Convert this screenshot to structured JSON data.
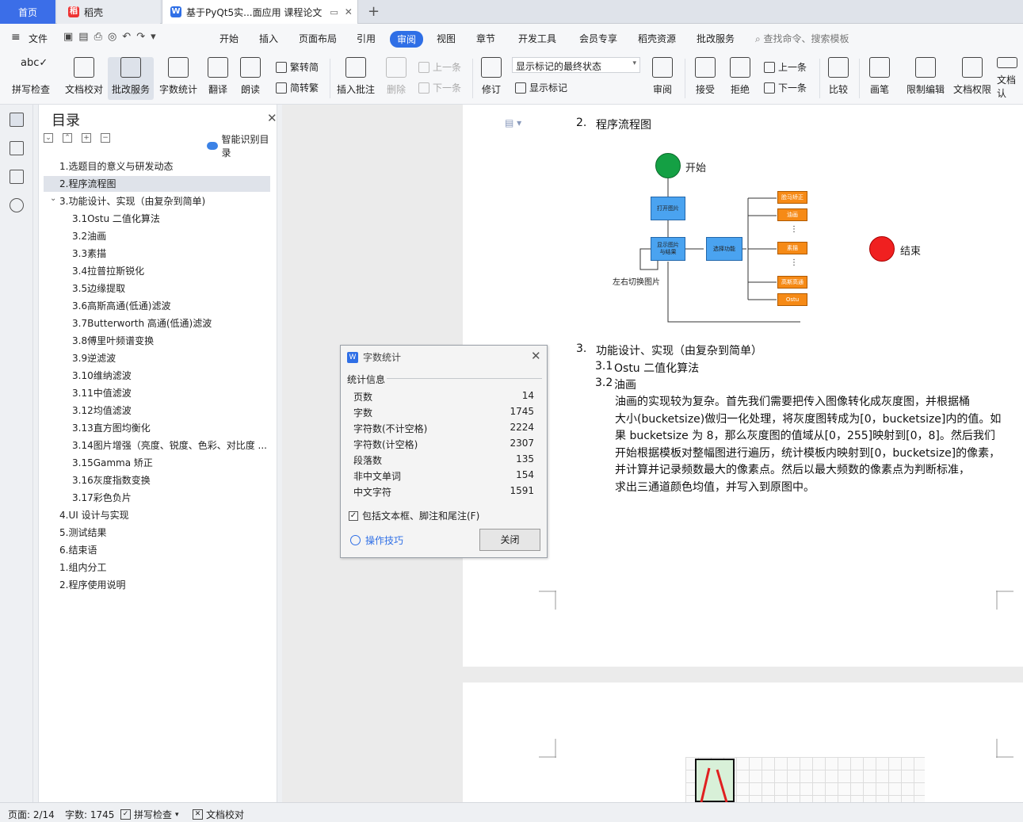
{
  "tabs": {
    "home": "首页",
    "daoke": "稻壳",
    "doc": "基于PyQt5实...面应用 课程论文"
  },
  "menubar": {
    "file": "文件",
    "items": [
      "开始",
      "插入",
      "页面布局",
      "引用",
      "审阅",
      "视图",
      "章节",
      "开发工具",
      "会员专享",
      "稻壳资源",
      "批改服务"
    ],
    "search": "查找命令、搜索模板"
  },
  "ribbon": {
    "spell": "拼写检查",
    "doccheck": "文档校对",
    "correct": "批改服务",
    "wordcount": "字数统计",
    "translate": "翻译",
    "read": "朗读",
    "trad": "繁转简",
    "simp": "简转繁",
    "insert_comment": "插入批注",
    "delete": "删除",
    "prev": "上一条",
    "next": "下一条",
    "revise": "修订",
    "markup_state": "显示标记的最终状态",
    "show_markup": "显示标记",
    "review": "审阅",
    "accept": "接受",
    "reject": "拒绝",
    "prev2": "上一条",
    "next2": "下一条",
    "compare": "比较",
    "pen": "画笔",
    "restrict": "限制编辑",
    "doc_perm": "文档权限",
    "doc_more": "文档认"
  },
  "toc": {
    "title": "目录",
    "smart": "智能识别目录",
    "items": [
      "1.选题目的意义与研发动态",
      "2.程序流程图",
      "3.功能设计、实现（由复杂到简单)",
      "3.1Ostu 二值化算法",
      "3.2油画",
      "3.3素描",
      "3.4拉普拉斯锐化",
      "3.5边缘提取",
      "3.6高斯高通(低通)滤波",
      "3.7Butterworth 高通(低通)滤波",
      "3.8傅里叶频谱变换",
      "3.9逆滤波",
      "3.10维纳滤波",
      "3.11中值滤波",
      "3.12均值滤波",
      "3.13直方图均衡化",
      "3.14图片增强（亮度、锐度、色彩、对比度 ...",
      "3.15Gamma 矫正",
      "3.16灰度指数变换",
      "3.17彩色负片",
      "4.UI 设计与实现",
      "5.测试结果",
      "6.结束语",
      "1.组内分工",
      "2.程序使用说明"
    ]
  },
  "doc": {
    "h2_num": "2.",
    "h2": "程序流程图",
    "h3_num": "3.",
    "h3": "功能设计、实现（由复杂到简单）",
    "s31_num": "3.1",
    "s31": "Ostu 二值化算法",
    "s32_num": "3.2",
    "s32": "油画",
    "para": [
      "油画的实现较为复杂。首先我们需要把传入图像转化成灰度图，并根据桶",
      "大小(bucketsize)做归一化处理，将灰度图转成为[0，bucketsize]内的值。如",
      "果 bucketsize 为 8，那么灰度图的值域从[0，255]映射到[0，8]。然后我们",
      "开始根据模板对整幅图进行遍历，统计模板内映射到[0，bucketsize]的像素，",
      "并计算并记录频数最大的像素点。然后以最大频数的像素点为判断标准，",
      "求出三通道颜色均值，并写入到原图中。"
    ]
  },
  "flowchart": {
    "start": "开始",
    "end": "结束",
    "open": "打开图片",
    "show": "显示图片与结果",
    "select": "选择功能",
    "loop": "左右切换图片",
    "f1": "脸马矫正",
    "f2": "油画",
    "f3": "素描",
    "f4": "高斯高通",
    "f5": "Ostu",
    "dots": "⋮"
  },
  "dialog": {
    "title": "字数统计",
    "header": "统计信息",
    "stats": [
      {
        "label": "页数",
        "value": "14"
      },
      {
        "label": "字数",
        "value": "1745"
      },
      {
        "label": "字符数(不计空格)",
        "value": "2224"
      },
      {
        "label": "字符数(计空格)",
        "value": "2307"
      },
      {
        "label": "段落数",
        "value": "135"
      },
      {
        "label": "非中文单词",
        "value": "154"
      },
      {
        "label": "中文字符",
        "value": "1591"
      }
    ],
    "include": "包括文本框、脚注和尾注(F)",
    "tips": "操作技巧",
    "close": "关闭"
  },
  "status": {
    "page": "页面: 2/14",
    "words": "字数: 1745",
    "spell": "拼写检查",
    "check": "文档校对"
  },
  "colors": {
    "accent": "#2f6fe6",
    "start": "#14a044",
    "end": "#f02020",
    "box_blue": "#4aa3f0",
    "box_orange": "#f68a16"
  }
}
